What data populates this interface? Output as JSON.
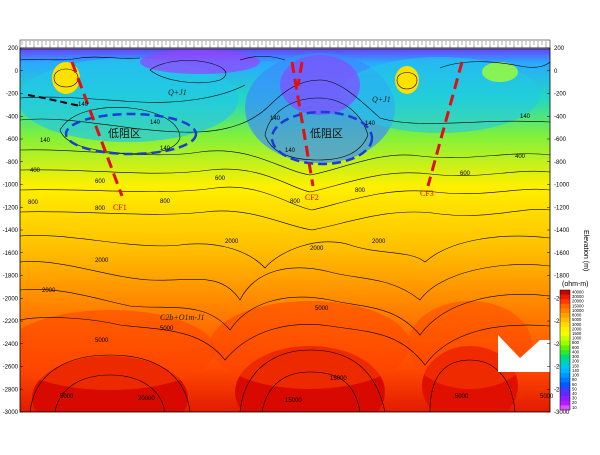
{
  "chart_data": {
    "type": "heatmap",
    "title": "",
    "ylabel_right": "Elevation (m)",
    "colorbar_title": "(ohm-m)",
    "ylim": [
      -3000,
      200
    ],
    "y_ticks": [
      200,
      0,
      -200,
      -400,
      -600,
      -800,
      -1000,
      -1200,
      -1400,
      -1600,
      -1800,
      -2000,
      -2200,
      -2400,
      -2600,
      -2800,
      -3000
    ],
    "colorbar_ticks": [
      40000,
      30000,
      20000,
      15000,
      10000,
      8000,
      5000,
      3000,
      2000,
      1500,
      1000,
      800,
      600,
      400,
      300,
      200,
      150,
      140,
      100,
      80,
      60,
      50,
      40,
      30,
      20,
      10
    ],
    "colorbar_colors": [
      "#c80000",
      "#e61e00",
      "#ff3c00",
      "#ff6400",
      "#ff8200",
      "#ffa000",
      "#ffbe00",
      "#ffdc00",
      "#fff000",
      "#f0ff00",
      "#c8ff00",
      "#96ff00",
      "#64f000",
      "#32e632",
      "#00dc78",
      "#00d2b4",
      "#00c8e6",
      "#00b4ff",
      "#0096ff",
      "#0078ff",
      "#005aff",
      "#3c3cff",
      "#6428ff",
      "#8c1eff",
      "#b41eff",
      "#dc50ff"
    ],
    "contour_labels": [
      "140",
      "140",
      "140",
      "140",
      "140",
      "140",
      "140",
      "140",
      "400",
      "400",
      "600",
      "600",
      "600",
      "800",
      "800",
      "800",
      "800",
      "800",
      "2000",
      "2000",
      "2000",
      "2000",
      "2000",
      "5000",
      "5000",
      "5000",
      "5000",
      "5000",
      "5000",
      "15000",
      "15000",
      "20000"
    ],
    "annotations": {
      "low_resistivity_zone": "低阻区",
      "strata_upper_left": "Q+J1",
      "strata_upper_right": "Q+J1",
      "strata_deep": "C2b+O1m-J1",
      "faults": [
        "CF1",
        "CF2",
        "CF3"
      ]
    }
  }
}
